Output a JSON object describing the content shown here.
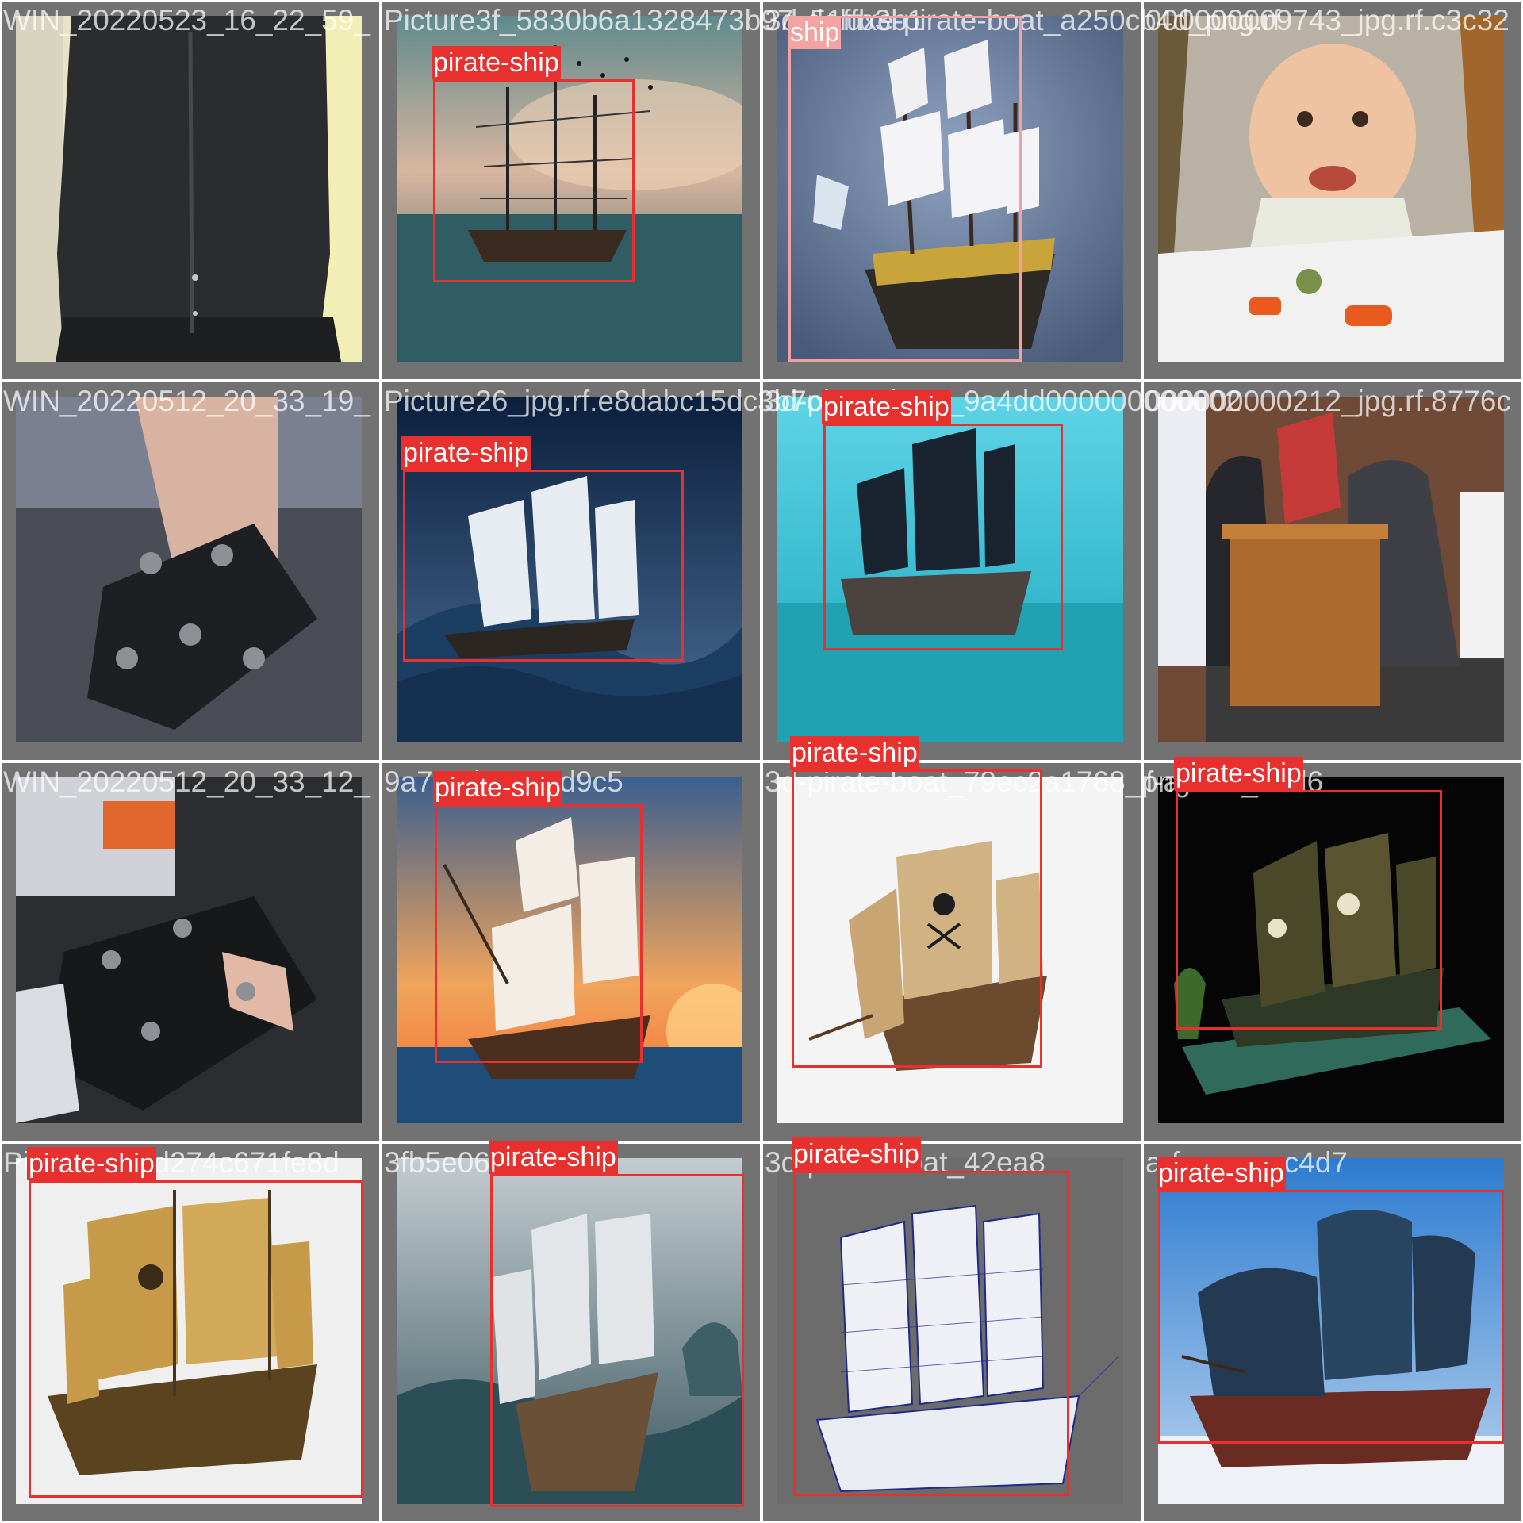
{
  "mosaic": {
    "box_color": "#e8302f",
    "background_color": "#727272",
    "tiles": [
      {
        "caption": "WIN_20220523_16_22_59_",
        "scene": "dark-fabric-closeup",
        "detections": []
      },
      {
        "caption": "Picture3f_5830b6a1328473b97_51ffb3b1",
        "scene": "galleon-stormy-sea",
        "detections": [
          {
            "label": "pirate-ship"
          }
        ]
      },
      {
        "caption": "3d-deluxe-pirate-boat_a250cb4d_png.rf",
        "scene": "3d-galleon-blue",
        "detections": [
          {
            "label": "ship"
          }
        ]
      },
      {
        "caption": "000000009743_jpg.rf.c3c32",
        "scene": "baby-high-chair",
        "detections": []
      },
      {
        "caption": "WIN_20220512_20_33_19_",
        "scene": "hand-robot-arm",
        "detections": []
      },
      {
        "caption": "Picture26_jpg.rf.e8dabc15dc3b7c",
        "scene": "clipper-ocean-waves",
        "detections": [
          {
            "label": "pirate-ship"
          }
        ]
      },
      {
        "caption": "3d-pirate-boat_9a4dd000000000002",
        "scene": "black-sail-ship",
        "detections": [
          {
            "label": "pirate-ship"
          }
        ]
      },
      {
        "caption": "000000000212_jpg.rf.8776c",
        "scene": "podium-speakers",
        "detections": []
      },
      {
        "caption": "WIN_20220512_20_33_12_",
        "scene": "robot-parts-table",
        "detections": []
      },
      {
        "caption": "9a7z0d11041d9c5",
        "scene": "ship-sunset",
        "detections": [
          {
            "label": "pirate-ship"
          }
        ]
      },
      {
        "caption": "3d-pirate-boat_79ec2a1768_png.rf",
        "scene": "skull-sail-ship",
        "detections": [
          {
            "label": "pirate-ship"
          }
        ]
      },
      {
        "caption": "f-a-a-a-_85d6",
        "scene": "model-ship-black",
        "detections": [
          {
            "label": "pirate-ship"
          }
        ]
      },
      {
        "caption": "Picture_rf.5d274c671fe8d",
        "scene": "golden-model-ship",
        "detections": [
          {
            "label": "pirate-ship"
          }
        ]
      },
      {
        "caption": "3fb5e063b5",
        "scene": "ghost-ship-storm",
        "detections": [
          {
            "label": "pirate-ship"
          }
        ]
      },
      {
        "caption": "3d-pirate-boat_42ea8",
        "scene": "wireframe-ship",
        "detections": [
          {
            "label": "pirate-ship"
          }
        ]
      },
      {
        "caption": "a-f-a-a-a-_c4d7",
        "scene": "lego-pirate-ship",
        "detections": [
          {
            "label": "pirate-ship"
          }
        ]
      }
    ]
  }
}
